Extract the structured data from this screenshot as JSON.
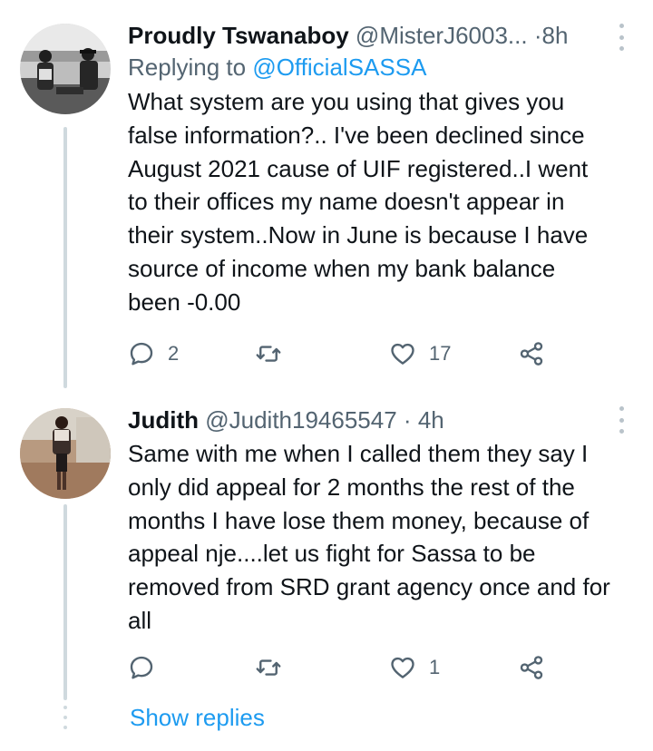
{
  "colors": {
    "accent": "#1d9bf0",
    "secondary_text": "#536471",
    "primary_text": "#0f1419",
    "thread_line": "#cfd9de"
  },
  "tweets": [
    {
      "display_name": "Proudly Tswanaboy",
      "handle": "@MisterJ6003...",
      "separator": "·",
      "time": "8h",
      "replying_prefix": "Replying to",
      "replying_to": "@OfficialSASSA",
      "text_lines": [
        "What system are you using that gives you",
        "false information?.. I've been declined since",
        "August 2021 cause of UIF registered..I went",
        "to their offices my name doesn't appear in",
        "their system..Now in June is because I have",
        "source of income when my bank balance",
        "been -0.00"
      ],
      "reply_count": "2",
      "retweet_count": "",
      "like_count": "17",
      "icons": {
        "more": "more-vertical-icon",
        "reply": "reply-icon",
        "retweet": "retweet-icon",
        "like": "heart-icon",
        "share": "share-icon"
      }
    },
    {
      "display_name": "Judith",
      "handle": "@Judith19465547",
      "separator": "·",
      "time": "4h",
      "text_lines": [
        "Same with me when I called them they say I",
        "only did appeal for 2 months the rest of the",
        "months I have lose them money, because of",
        "appeal nje....let us fight for Sassa to be",
        "removed from SRD grant agency once and for",
        "all"
      ],
      "reply_count": "",
      "retweet_count": "",
      "like_count": "1",
      "icons": {
        "more": "more-vertical-icon",
        "reply": "reply-icon",
        "retweet": "retweet-icon",
        "like": "heart-icon",
        "share": "share-icon"
      }
    }
  ],
  "show_replies_label": "Show replies"
}
